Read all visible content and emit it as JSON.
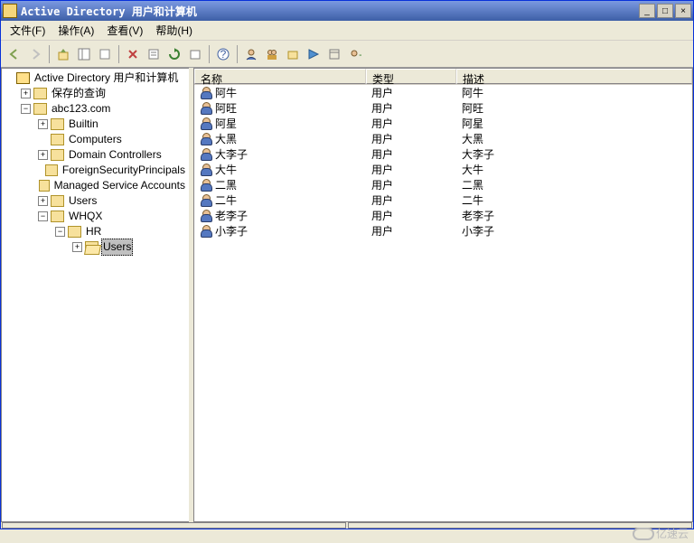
{
  "window": {
    "title": "Active Directory 用户和计算机",
    "buttons": {
      "min": "_",
      "max": "□",
      "close": "×"
    }
  },
  "menu": {
    "file": "文件(F)",
    "action": "操作(A)",
    "view": "查看(V)",
    "help": "帮助(H)"
  },
  "tree": {
    "root": "Active Directory 用户和计算机",
    "saved_queries": "保存的查询",
    "domain": "abc123.com",
    "builtin": "Builtin",
    "computers": "Computers",
    "domain_controllers": "Domain Controllers",
    "fsp": "ForeignSecurityPrincipals",
    "msa": "Managed Service Accounts",
    "users": "Users",
    "whqx": "WHQX",
    "hr": "HR",
    "hr_users": "Users"
  },
  "columns": {
    "name": "名称",
    "type": "类型",
    "desc": "描述"
  },
  "rows": [
    {
      "name": "阿牛",
      "type": "用户",
      "desc": "阿牛"
    },
    {
      "name": "阿旺",
      "type": "用户",
      "desc": "阿旺"
    },
    {
      "name": "阿星",
      "type": "用户",
      "desc": "阿星"
    },
    {
      "name": "大黑",
      "type": "用户",
      "desc": "大黑"
    },
    {
      "name": "大李子",
      "type": "用户",
      "desc": "大李子"
    },
    {
      "name": "大牛",
      "type": "用户",
      "desc": "大牛"
    },
    {
      "name": "二黑",
      "type": "用户",
      "desc": "二黑"
    },
    {
      "name": "二牛",
      "type": "用户",
      "desc": "二牛"
    },
    {
      "name": "老李子",
      "type": "用户",
      "desc": "老李子"
    },
    {
      "name": "小李子",
      "type": "用户",
      "desc": "小李子"
    }
  ],
  "watermark": "亿速云"
}
